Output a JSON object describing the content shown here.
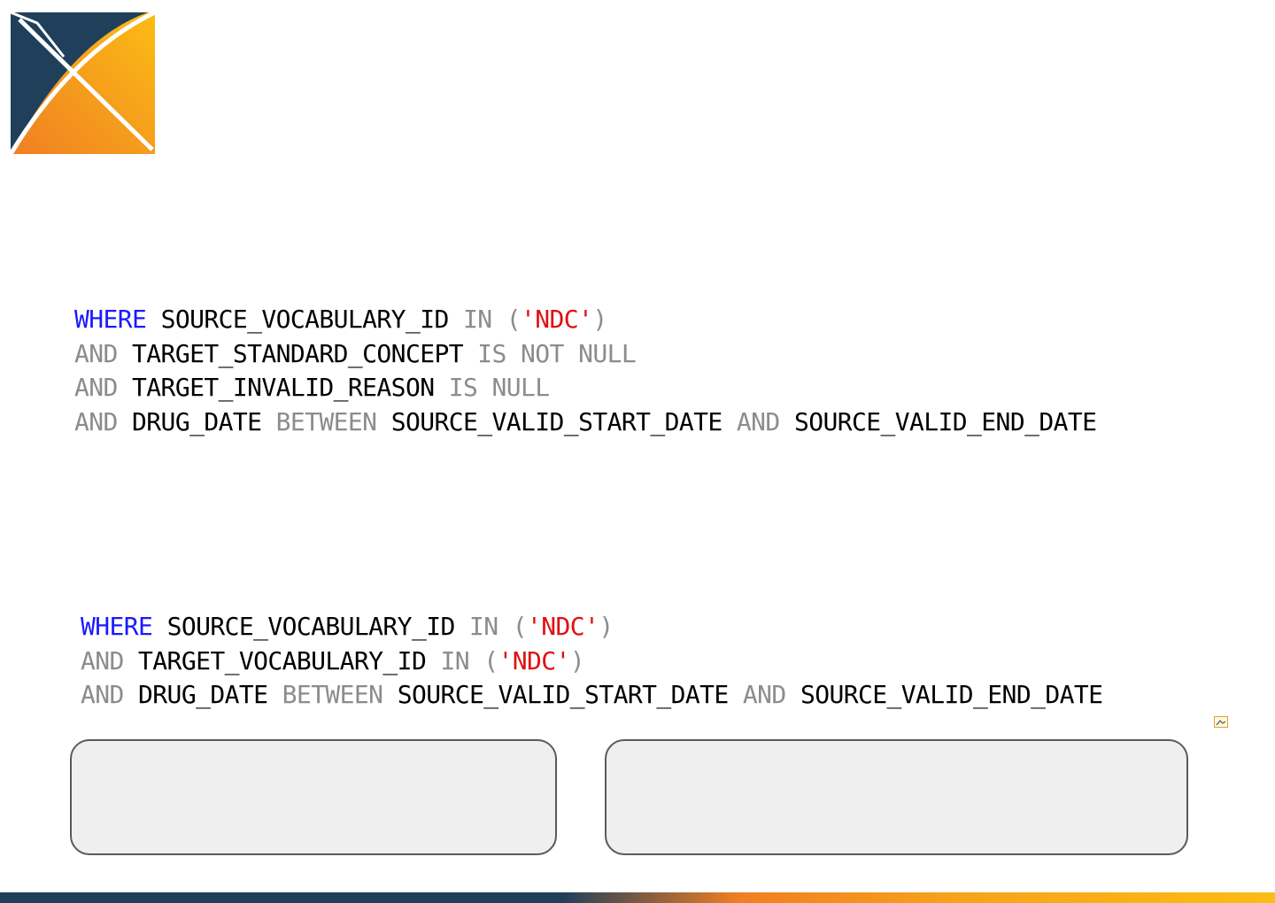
{
  "logo": {
    "icon": "ohdsi-x-logo",
    "colors": {
      "dark": "#1f3f5b",
      "orange": "#f07f22",
      "yellow": "#fbbd13"
    }
  },
  "colors": {
    "keyword_primary": "#1a1aff",
    "keyword_secondary": "#8c8c8c",
    "identifier": "#000000",
    "string": "#e01010",
    "box_background": "#efefef",
    "box_border": "#5a5a5a"
  },
  "code_blocks": [
    {
      "lines": [
        [
          {
            "t": "WHERE",
            "k": "kw1"
          },
          {
            "t": " ",
            "k": "ident"
          },
          {
            "t": "SOURCE_VOCABULARY_ID",
            "k": "ident"
          },
          {
            "t": " ",
            "k": "ident"
          },
          {
            "t": "IN",
            "k": "kw2"
          },
          {
            "t": " ",
            "k": "ident"
          },
          {
            "t": "(",
            "k": "op"
          },
          {
            "t": "'NDC'",
            "k": "str"
          },
          {
            "t": ")",
            "k": "op"
          }
        ],
        [
          {
            "t": "AND",
            "k": "kw2"
          },
          {
            "t": " ",
            "k": "ident"
          },
          {
            "t": "TARGET_STANDARD_CONCEPT",
            "k": "ident"
          },
          {
            "t": " ",
            "k": "ident"
          },
          {
            "t": "IS",
            "k": "kw2"
          },
          {
            "t": " ",
            "k": "ident"
          },
          {
            "t": "NOT",
            "k": "kw2"
          },
          {
            "t": " ",
            "k": "ident"
          },
          {
            "t": "NULL",
            "k": "kw2"
          }
        ],
        [
          {
            "t": "AND",
            "k": "kw2"
          },
          {
            "t": " ",
            "k": "ident"
          },
          {
            "t": "TARGET_INVALID_REASON",
            "k": "ident"
          },
          {
            "t": " ",
            "k": "ident"
          },
          {
            "t": "IS",
            "k": "kw2"
          },
          {
            "t": " ",
            "k": "ident"
          },
          {
            "t": "NULL",
            "k": "kw2"
          }
        ],
        [
          {
            "t": "AND",
            "k": "kw2"
          },
          {
            "t": " ",
            "k": "ident"
          },
          {
            "t": "DRUG_DATE",
            "k": "ident"
          },
          {
            "t": " ",
            "k": "ident"
          },
          {
            "t": "BETWEEN",
            "k": "kw2"
          },
          {
            "t": " ",
            "k": "ident"
          },
          {
            "t": "SOURCE_VALID_START_DATE",
            "k": "ident"
          },
          {
            "t": " ",
            "k": "ident"
          },
          {
            "t": "AND",
            "k": "kw2"
          },
          {
            "t": " ",
            "k": "ident"
          },
          {
            "t": "SOURCE_VALID_END_DATE",
            "k": "ident"
          }
        ]
      ]
    },
    {
      "lines": [
        [
          {
            "t": "WHERE",
            "k": "kw1"
          },
          {
            "t": " ",
            "k": "ident"
          },
          {
            "t": "SOURCE_VOCABULARY_ID",
            "k": "ident"
          },
          {
            "t": " ",
            "k": "ident"
          },
          {
            "t": "IN",
            "k": "kw2"
          },
          {
            "t": " ",
            "k": "ident"
          },
          {
            "t": "(",
            "k": "op"
          },
          {
            "t": "'NDC'",
            "k": "str"
          },
          {
            "t": ")",
            "k": "op"
          }
        ],
        [
          {
            "t": "AND",
            "k": "kw2"
          },
          {
            "t": " ",
            "k": "ident"
          },
          {
            "t": "TARGET_VOCABULARY_ID",
            "k": "ident"
          },
          {
            "t": " ",
            "k": "ident"
          },
          {
            "t": "IN",
            "k": "kw2"
          },
          {
            "t": " ",
            "k": "ident"
          },
          {
            "t": "(",
            "k": "op"
          },
          {
            "t": "'NDC'",
            "k": "str"
          },
          {
            "t": ")",
            "k": "op"
          }
        ],
        [
          {
            "t": "AND",
            "k": "kw2"
          },
          {
            "t": " ",
            "k": "ident"
          },
          {
            "t": "DRUG_DATE",
            "k": "ident"
          },
          {
            "t": " ",
            "k": "ident"
          },
          {
            "t": "BETWEEN",
            "k": "kw2"
          },
          {
            "t": " ",
            "k": "ident"
          },
          {
            "t": "SOURCE_VALID_START_DATE",
            "k": "ident"
          },
          {
            "t": " ",
            "k": "ident"
          },
          {
            "t": "AND",
            "k": "kw2"
          },
          {
            "t": " ",
            "k": "ident"
          },
          {
            "t": "SOURCE_VALID_END_DATE",
            "k": "ident"
          }
        ]
      ]
    }
  ],
  "boxes": [
    {
      "text": ""
    },
    {
      "text": ""
    }
  ],
  "small_icon": {
    "icon": "image-placeholder-icon"
  }
}
